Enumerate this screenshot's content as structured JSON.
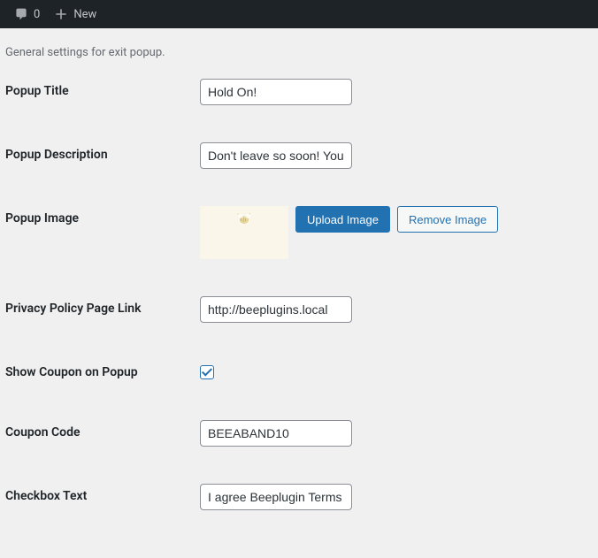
{
  "adminBar": {
    "commentCount": "0",
    "newLabel": "New"
  },
  "page": {
    "subtitle": "General settings for exit popup."
  },
  "fields": {
    "popupTitle": {
      "label": "Popup Title",
      "value": "Hold On!"
    },
    "popupDescription": {
      "label": "Popup Description",
      "value": "Don't leave so soon! You h"
    },
    "popupImage": {
      "label": "Popup Image",
      "uploadLabel": "Upload Image",
      "removeLabel": "Remove Image"
    },
    "privacyLink": {
      "label": "Privacy Policy Page Link",
      "value": "http://beeplugins.local"
    },
    "showCoupon": {
      "label": "Show Coupon on Popup",
      "checked": true
    },
    "couponCode": {
      "label": "Coupon Code",
      "value": "BEEABAND10"
    },
    "checkboxText": {
      "label": "Checkbox Text",
      "value": "I agree Beeplugin Terms o"
    }
  }
}
